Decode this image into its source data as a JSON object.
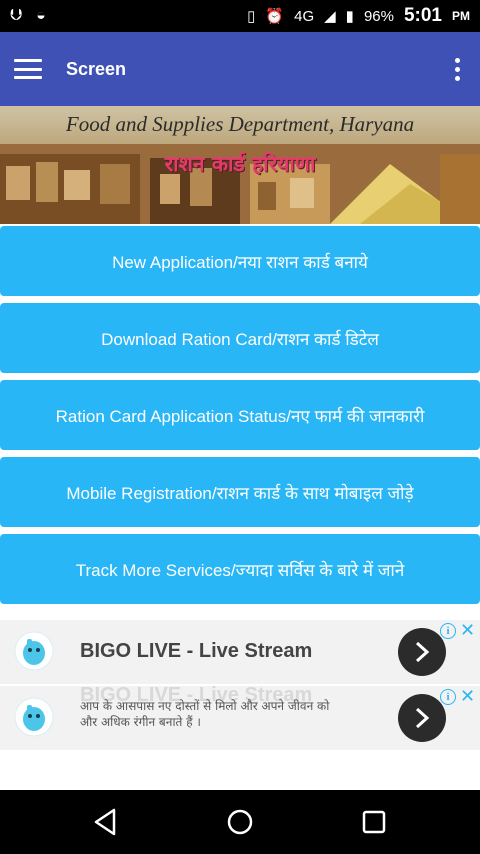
{
  "status_bar": {
    "battery": "96%",
    "network": "4G",
    "time": "5:01",
    "ampm": "PM"
  },
  "app_bar": {
    "title": "Screen"
  },
  "banner": {
    "title": "Food and Supplies Department, Haryana",
    "subtitle": "राशन कार्ड हरियाणा"
  },
  "menu": {
    "items": [
      "New Application/नया राशन कार्ड बनाये",
      "Download Ration Card/राशन कार्ड डिटेल",
      "Ration Card Application Status/नए फार्म की जानकारी",
      "Mobile Registration/राशन कार्ड के साथ मोबाइल जोड़े",
      "Track More Services/ज्यादा सर्विस के बारे में जाने"
    ]
  },
  "ads": [
    {
      "headline": "BIGO LIVE - Live Stream"
    },
    {
      "ghost_headline": "BIGO LIVE - Live Stream",
      "description": "आप के आसपास नए दोस्तों से मिलो और अपने जीवन को और अधिक रंगीन बनाते हैं ।"
    }
  ],
  "colors": {
    "app_bar": "#3F51B5",
    "button": "#29B6F6",
    "ad_info": "#29B6F6"
  }
}
